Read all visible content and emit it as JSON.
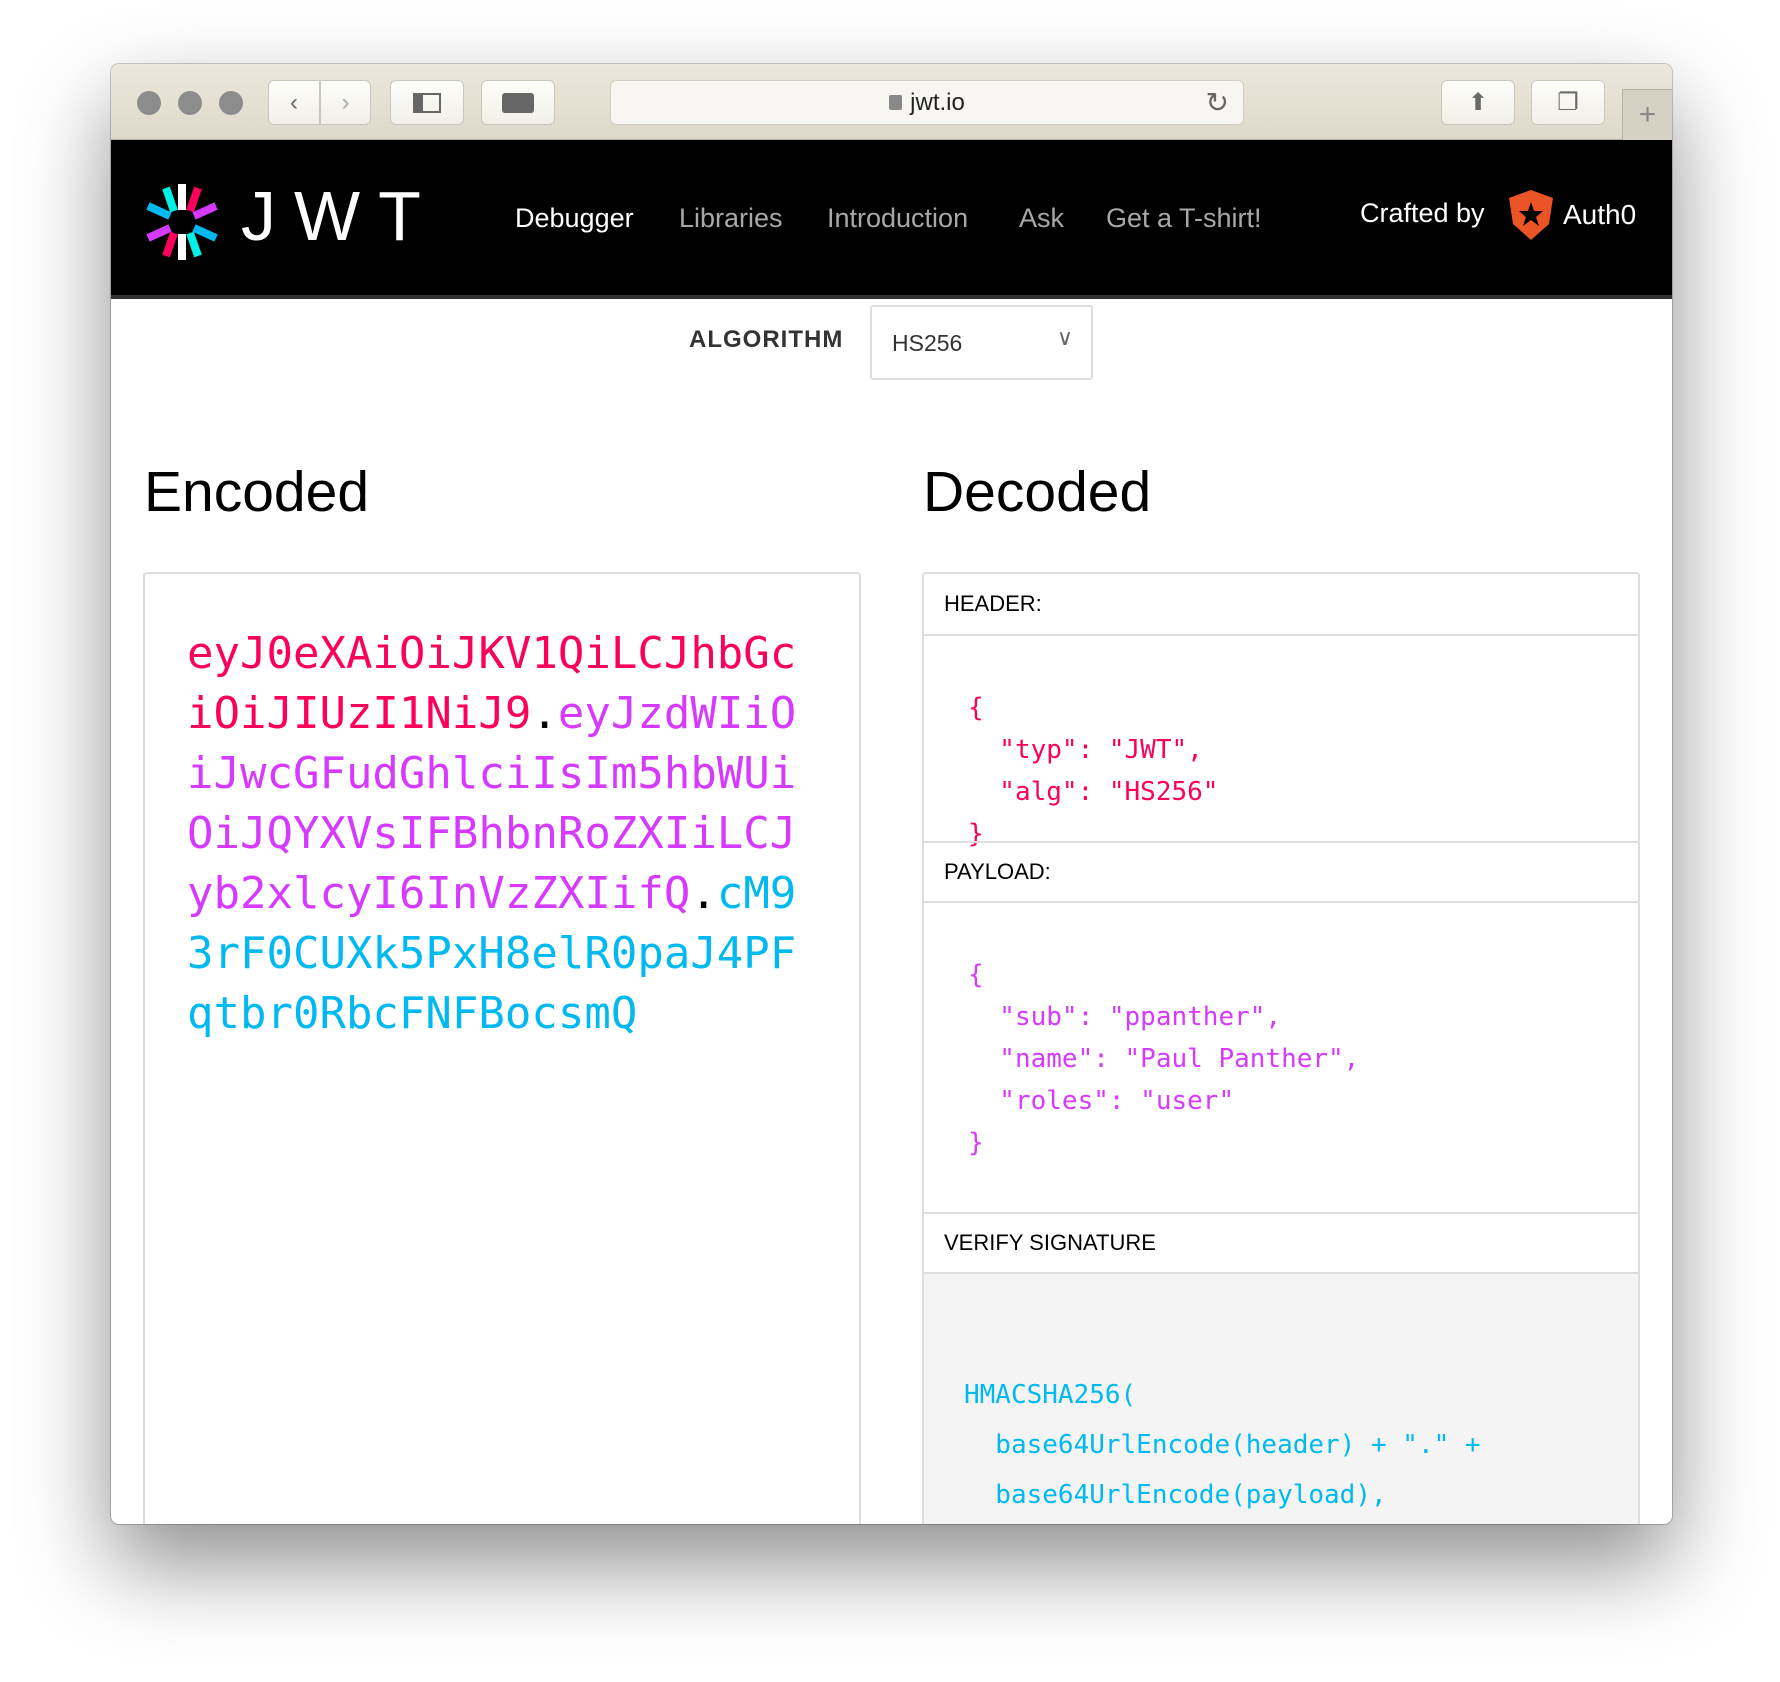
{
  "browser": {
    "url": "jwt.io"
  },
  "nav": {
    "logo_text": "JWT",
    "items": [
      {
        "label": "Debugger",
        "active": true
      },
      {
        "label": "Libraries"
      },
      {
        "label": "Introduction"
      },
      {
        "label": "Ask"
      },
      {
        "label": "Get a T-shirt!"
      }
    ],
    "crafted_by": "Crafted by",
    "brand": "Auth0"
  },
  "algorithm": {
    "label": "ALGORITHM",
    "selected": "HS256"
  },
  "encoded": {
    "title": "Encoded",
    "lines": [
      [
        {
          "t": "eyJ0eXAiOiJKV1QiLCJhbGc",
          "c": "h"
        }
      ],
      [
        {
          "t": "iOiJIUzI1NiJ9",
          "c": "h"
        },
        {
          "t": ".",
          "c": "d"
        },
        {
          "t": "eyJzdWIiO",
          "c": "p"
        }
      ],
      [
        {
          "t": "iJwcGFudGhlciIsIm5hbWUi",
          "c": "p"
        }
      ],
      [
        {
          "t": "OiJQYXVsIFBhbnRoZXIiLCJ",
          "c": "p"
        }
      ],
      [
        {
          "t": "yb2xlcyI6InVzZXIifQ",
          "c": "p"
        },
        {
          "t": ".",
          "c": "d"
        },
        {
          "t": "cM9",
          "c": "s"
        }
      ],
      [
        {
          "t": "3rF0CUXk5PxH8elR0paJ4PF",
          "c": "s"
        }
      ],
      [
        {
          "t": "qtbr0RbcFNFBocsmQ",
          "c": "s"
        }
      ]
    ]
  },
  "decoded": {
    "title": "Decoded",
    "header": {
      "label": "HEADER:",
      "code": "{\n  \"typ\": \"JWT\",\n  \"alg\": \"HS256\"\n}"
    },
    "payload": {
      "label": "PAYLOAD:",
      "code": "{\n  \"sub\": \"ppanther\",\n  \"name\": \"Paul Panther\",\n  \"roles\": \"user\"\n}"
    },
    "signature": {
      "label": "VERIFY SIGNATURE",
      "code": "HMACSHA256(\n  base64UrlEncode(header) + \".\" +\n  base64UrlEncode(payload),"
    }
  },
  "colors": {
    "header": "#fb015b",
    "payload": "#d63aff",
    "signature": "#00b9f1",
    "dot": "#000000",
    "auth0": "#eb5424"
  }
}
